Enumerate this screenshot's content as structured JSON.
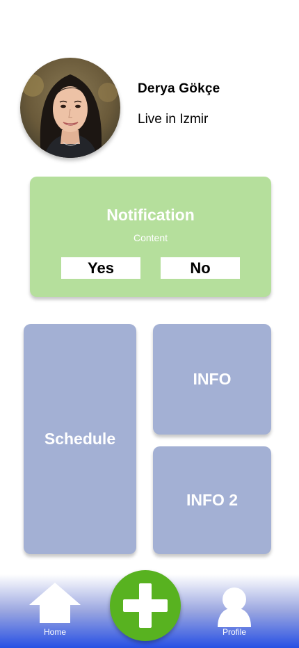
{
  "profile": {
    "name": "Derya Gökçe",
    "location": "Live in Izmir",
    "avatar_icon": "profile-photo"
  },
  "notification": {
    "title": "Notification",
    "content": "Content",
    "yes_label": "Yes",
    "no_label": "No",
    "color": "#b5df9c"
  },
  "tiles": {
    "schedule": "Schedule",
    "info": "INFO",
    "info2": "INFO 2",
    "color": "#a3b0d4"
  },
  "nav": {
    "home_label": "Home",
    "home_icon": "home-icon",
    "add_icon": "plus-icon",
    "add_color": "#58b220",
    "profile_label": "Profile",
    "profile_icon": "user-icon",
    "gradient_bottom": "#2750e4"
  }
}
